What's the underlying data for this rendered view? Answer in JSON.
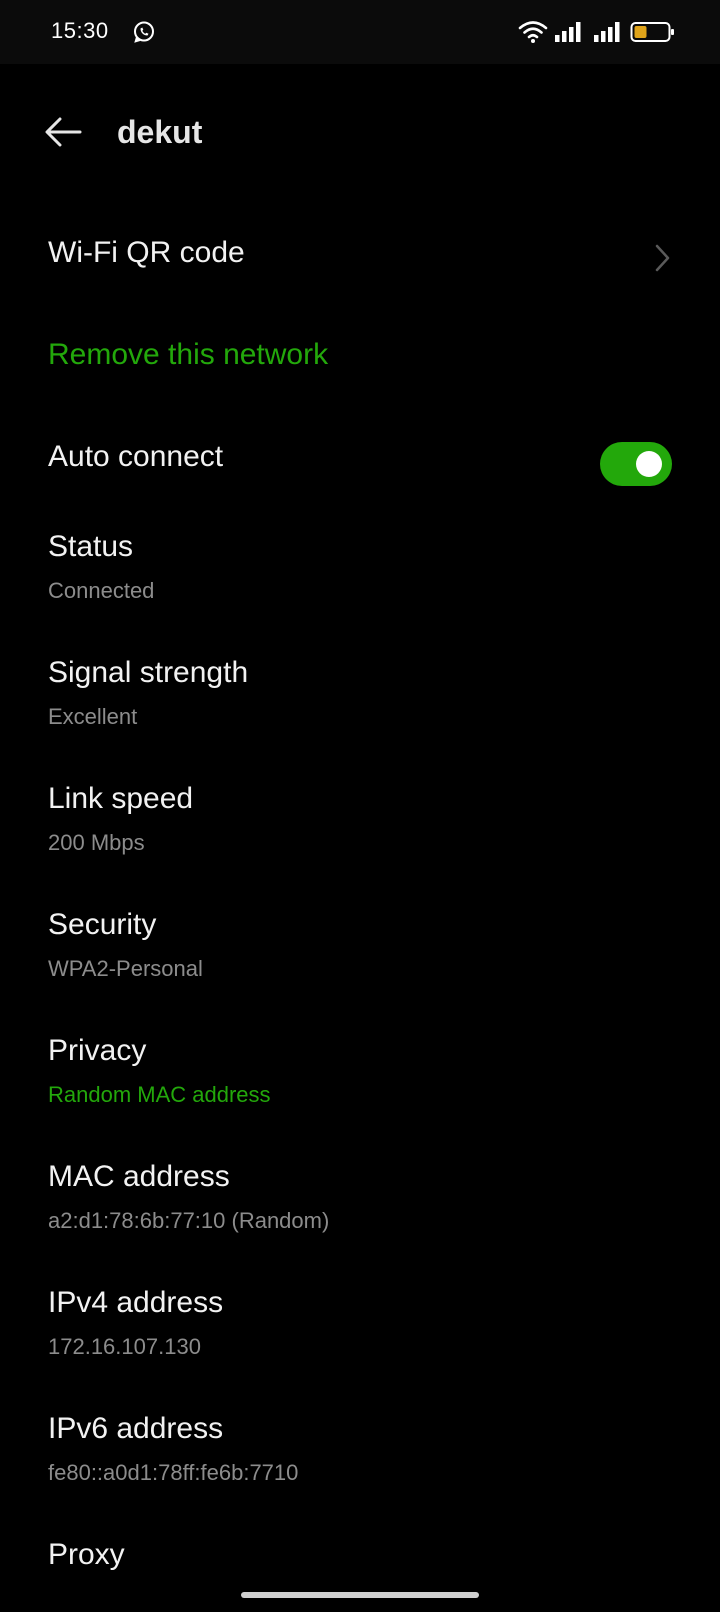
{
  "status_bar": {
    "time": "15:30",
    "battery_color": "#e0a41a"
  },
  "header": {
    "title": "dekut"
  },
  "accent_color": "#23a80b",
  "wifi_qr": {
    "label": "Wi-Fi QR code"
  },
  "remove_network": {
    "label": "Remove this network"
  },
  "auto_connect": {
    "label": "Auto connect",
    "enabled": true
  },
  "details": [
    {
      "title": "Status",
      "value": "Connected",
      "accent": false
    },
    {
      "title": "Signal strength",
      "value": "Excellent",
      "accent": false
    },
    {
      "title": "Link speed",
      "value": "200 Mbps",
      "accent": false
    },
    {
      "title": "Security",
      "value": "WPA2-Personal",
      "accent": false
    },
    {
      "title": "Privacy",
      "value": "Random MAC address",
      "accent": true
    },
    {
      "title": "MAC address",
      "value": "a2:d1:78:6b:77:10 (Random)",
      "accent": false
    },
    {
      "title": "IPv4 address",
      "value": "172.16.107.130",
      "accent": false
    },
    {
      "title": "IPv6 address",
      "value": "fe80::a0d1:78ff:fe6b:7710",
      "accent": false
    }
  ],
  "proxy": {
    "title": "Proxy"
  }
}
